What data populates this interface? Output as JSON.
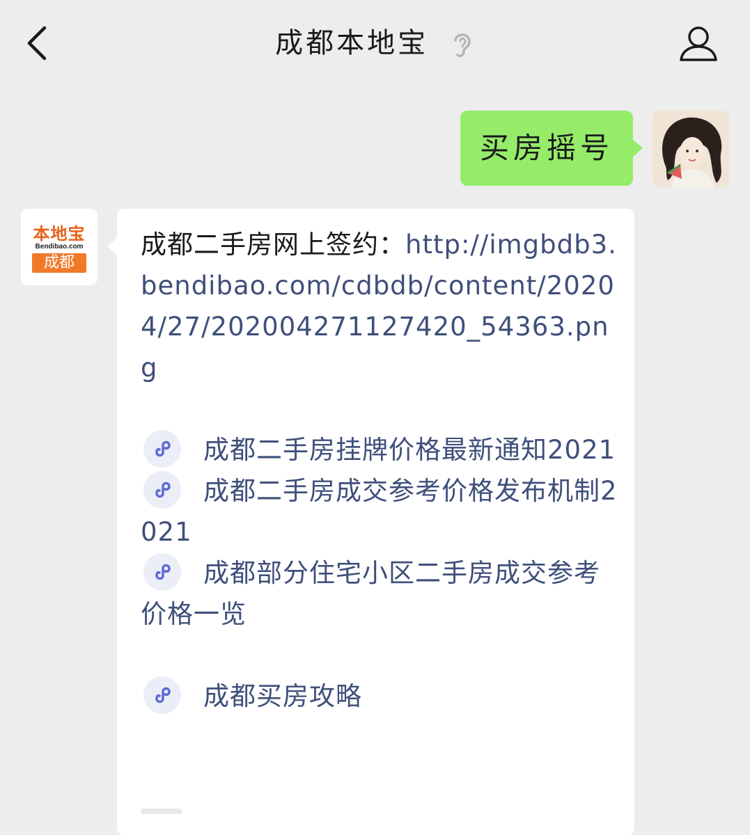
{
  "header": {
    "title": "成都本地宝",
    "back_icon": "chevron-left-icon",
    "ear_icon": "ear-icon",
    "profile_icon": "person-icon"
  },
  "conversation": {
    "user_message": "买房摇号",
    "bot_avatar": {
      "brand": "本地宝",
      "domain": "Bendibao.com",
      "city": "成都"
    },
    "bot_message": {
      "intro": "成都二手房网上签约：",
      "url": "http://imgbdb3.bendibao.com/cdbdb/content/20204/27/202004271127420_54363.png",
      "url_display": "http://\nimgbdb3.bendibao.com/cdbdb/\ncontent/20204/27/2020042711274\n2_54363.png",
      "links": [
        {
          "label": "成都二手房挂牌价格最新通知2021"
        },
        {
          "label": "成都二手房成交参考价格发布机制2021"
        },
        {
          "label": "成都部分住宅小区二手房成交参考价格一览"
        },
        {
          "label": "成都买房攻略"
        }
      ]
    }
  },
  "colors": {
    "background": "#ededed",
    "user_bubble": "#95ec69",
    "bot_bubble": "#ffffff",
    "link_text": "#3f4f7a",
    "brand_orange": "#f07a2a"
  }
}
